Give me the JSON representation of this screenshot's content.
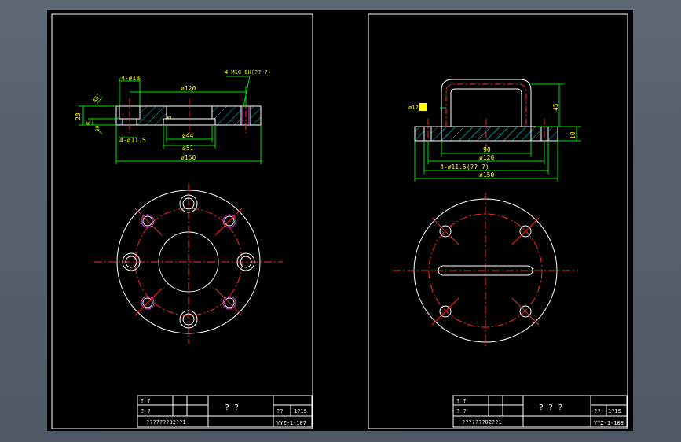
{
  "sheets": [
    {
      "title_block": {
        "row1_left": "? ?",
        "row2_left": "? ?",
        "part_name": "? ?",
        "material_label": "??",
        "scale": "1?15",
        "school": "???????02??1",
        "drawing_no": "YYZ-1-107"
      },
      "dims": {
        "holes_top": "4-ø18",
        "threads": "4-M10-6H(?? ?)",
        "bolt_circle": "ø120",
        "angle": "45°",
        "height": "20",
        "thickness": "8",
        "step": "10",
        "small_holes": "4-ø11.5",
        "slot": "5",
        "bore": "ø44",
        "counterbore": "ø51",
        "outer": "ø150"
      }
    },
    {
      "title_block": {
        "row1_left": "? ?",
        "row2_left": "? ?",
        "part_name": "? ? ?",
        "material_label": "??",
        "scale": "1?15",
        "school": "???????02??1",
        "drawing_no": "YYZ-1-108"
      },
      "dims": {
        "handle_dia": "ø12",
        "handle_height": "45",
        "plate_thickness": "10",
        "handle_span": "90",
        "bolt_circle": "ø120",
        "holes": "4-ø11.5(?? ?)",
        "outer": "ø150"
      }
    }
  ],
  "colors": {
    "background": "#000000",
    "outline": "#ffffff",
    "centerline": "#ff2a2a",
    "dimension": "#00e000",
    "hatch": "#00c8c8",
    "text": "#ffff00",
    "hidden": "#e040e0"
  }
}
